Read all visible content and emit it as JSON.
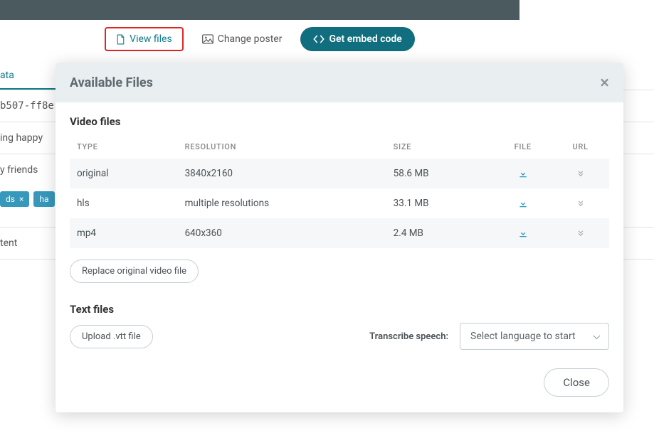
{
  "toolbar": {
    "view_files": "View files",
    "change_poster": "Change poster",
    "embed": "Get embed code"
  },
  "bg": {
    "tab": "ata",
    "id_line": "b507-ff8e-",
    "row1": "ing happy",
    "row2": "y friends",
    "chip1": "ds",
    "chip2": "ha",
    "row3": "tent"
  },
  "modal": {
    "title": "Available Files",
    "section_video": "Video files",
    "section_text": "Text files",
    "headers": {
      "type": "TYPE",
      "resolution": "RESOLUTION",
      "size": "SIZE",
      "file": "FILE",
      "url": "URL"
    },
    "rows": [
      {
        "type": "original",
        "resolution": "3840x2160",
        "size": "58.6 MB"
      },
      {
        "type": "hls",
        "resolution": "multiple resolutions",
        "size": "33.1 MB"
      },
      {
        "type": "mp4",
        "resolution": "640x360",
        "size": "2.4 MB"
      }
    ],
    "replace_btn": "Replace original video file",
    "upload_btn": "Upload .vtt file",
    "transcribe_label": "Transcribe speech:",
    "lang_placeholder": "Select language to start",
    "close": "Close"
  }
}
